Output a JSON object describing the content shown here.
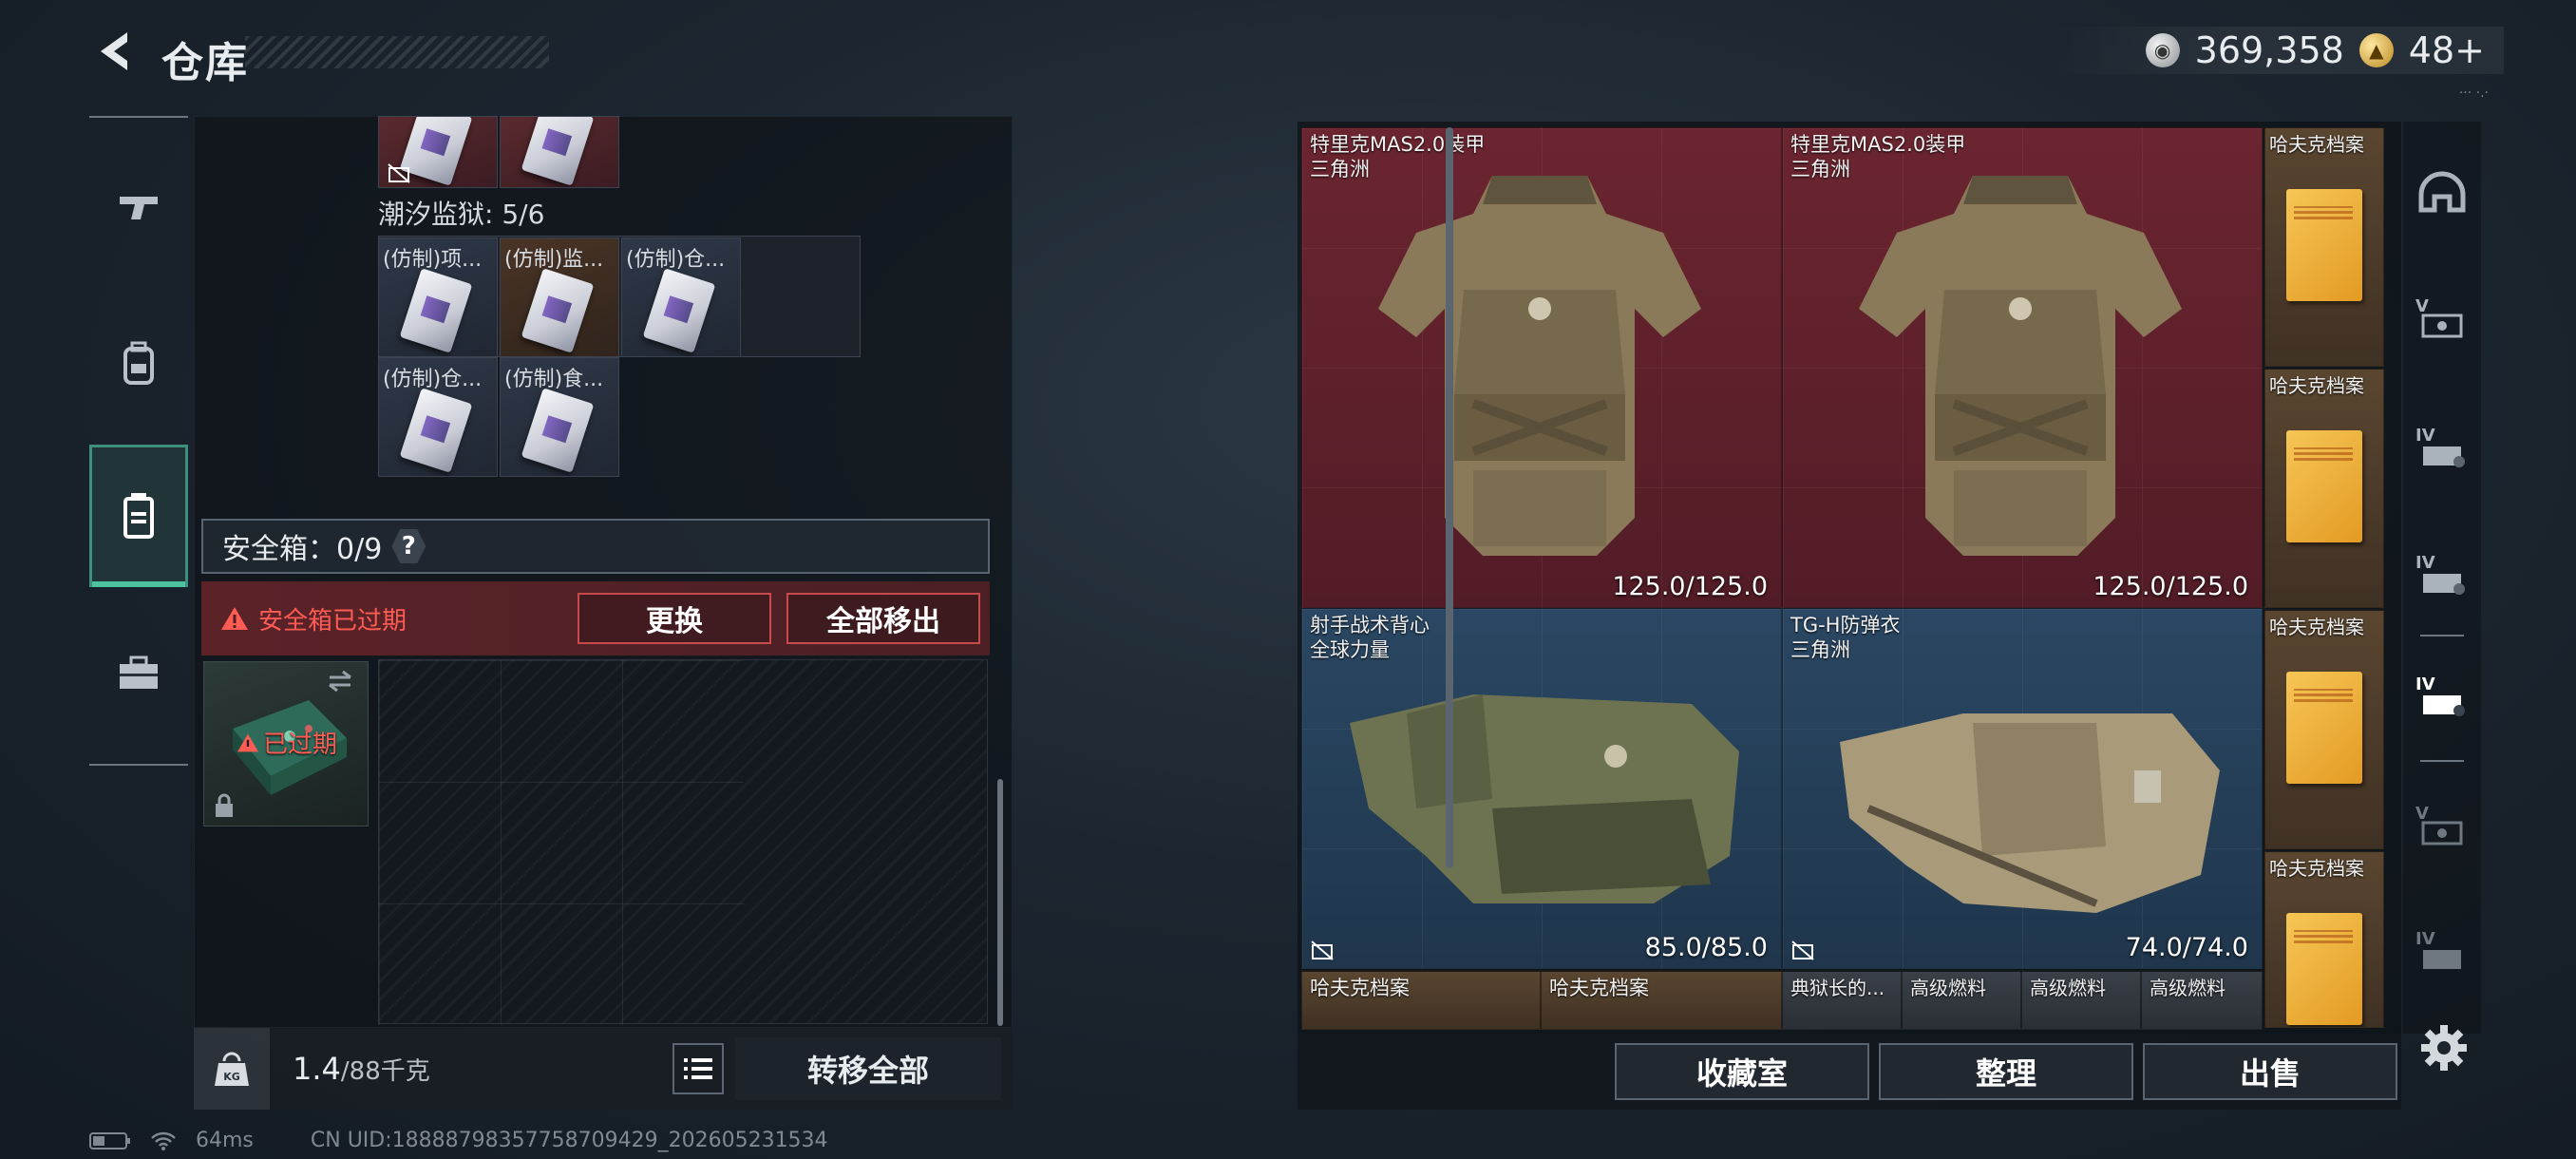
{
  "header": {
    "title": "仓库"
  },
  "currency": {
    "silver": "369,358",
    "gold": "48+"
  },
  "left": {
    "tide_prison_label": "潮汐监狱: 5/6",
    "items": [
      "(仿制)项...",
      "(仿制)监...",
      "(仿制)仓...",
      "(仿制)仓...",
      "(仿制)食..."
    ],
    "safe_box_label": "安全箱：0/9",
    "help": "?",
    "expired_msg": "安全箱已过期",
    "replace_btn": "更换",
    "remove_all_btn": "全部移出",
    "expired_tag": "已过期",
    "weight_value": "1.4",
    "weight_max": "/88千克",
    "transfer_all_btn": "转移全部"
  },
  "right": {
    "tiles": [
      {
        "name": "特里克MAS2.0装甲",
        "sub": "三角洲",
        "durability": "125.0/125.0"
      },
      {
        "name": "特里克MAS2.0装甲",
        "sub": "三角洲",
        "durability": "125.0/125.0"
      },
      {
        "name": "射手战术背心",
        "sub": "全球力量",
        "durability": "85.0/85.0"
      },
      {
        "name": "TG-H防弹衣",
        "sub": "三角洲",
        "durability": "74.0/74.0"
      }
    ],
    "files": [
      "哈夫克档案",
      "哈夫克档案",
      "哈夫克档案",
      "哈夫克档案"
    ],
    "bottom_row": [
      "哈夫克档案",
      "哈夫克档案",
      "典狱长的...",
      "高级燃料",
      "高级燃料",
      "高级燃料"
    ],
    "buttons": {
      "collection": "收藏室",
      "organize": "整理",
      "sell": "出售"
    }
  },
  "status": {
    "ping": "64ms",
    "uid": "CN UID:1888879835775870942​9_202605231534"
  },
  "colors": {
    "accent_green": "#4cc2a0",
    "warning_red": "#ff5b55",
    "armor_red": "#6b2530",
    "armor_blue": "#2a4763"
  }
}
